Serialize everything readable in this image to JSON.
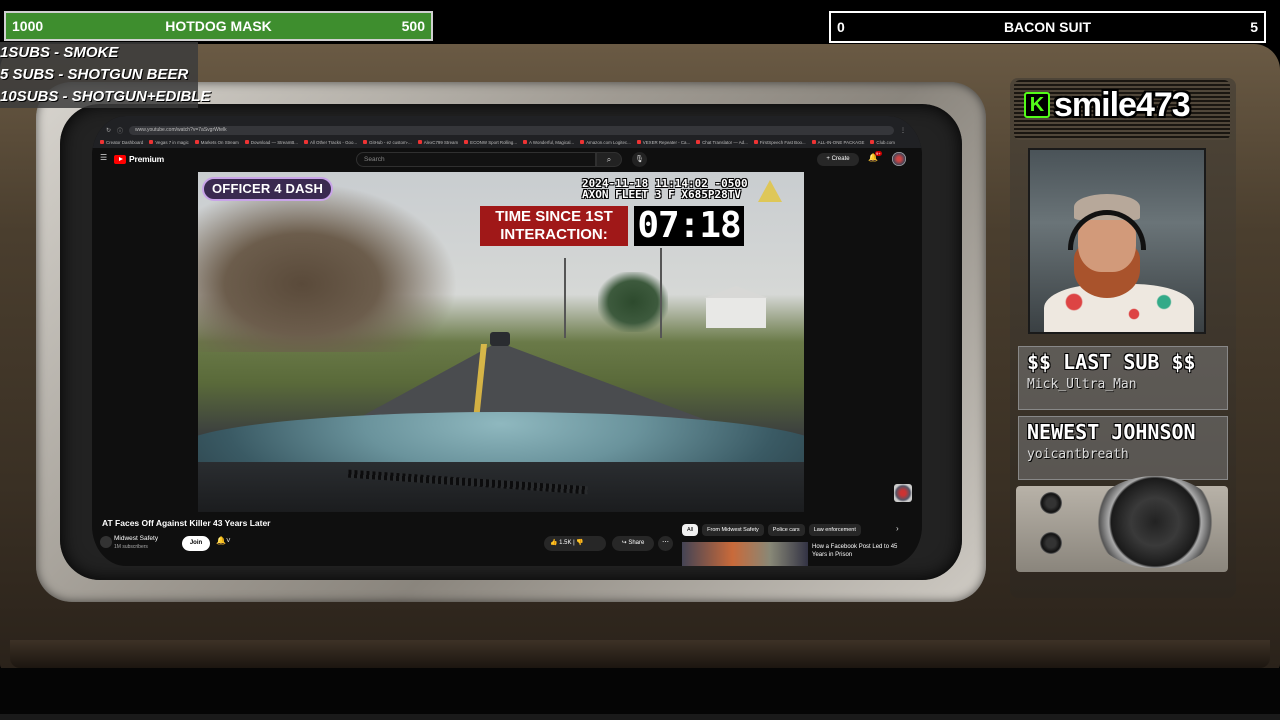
{
  "goals": {
    "left": {
      "min": "1000",
      "title": "HOTDOG MASK",
      "max": "500"
    },
    "right": {
      "min": "0",
      "title": "BACON SUIT",
      "max": "5"
    }
  },
  "sub_rewards": [
    "1SUBS   - SMOKE",
    "5 SUBS  - SHOTGUN BEER",
    "10SUBS - SHOTGUN+EDIBLE"
  ],
  "browser": {
    "url": "www.youtube.com/watch?v=7aSvgrWtelk",
    "bookmarks": [
      "Creator Dashboard",
      "Vegas 7 in magic",
      "Markets On Stream",
      "Download — StreamB...",
      "All Other Tracks - Goo...",
      "GitHub - ez custom-...",
      "AlexC799 Stream",
      "ECONW Sport Rolling...",
      "A Wonderful, Magical...",
      "Amazon.com Logitec...",
      "VEXER Repeater - Ca...",
      "Chat Translator — Ad...",
      "FirstSpeech Fast Boo...",
      "ALL-IN-ONE PACKAGE",
      "Club.com"
    ]
  },
  "youtube": {
    "logo_text": "Premium",
    "search_placeholder": "Search",
    "create_label": "Create",
    "video": {
      "badge": "OFFICER 4 DASH",
      "timestamp_line1": "2024-11-18 11:14:02 -0500",
      "timestamp_line2": "AXON FLEET 3 F X685P28TV",
      "time_since_line1": "TIME SINCE 1ST",
      "time_since_line2": "INTERACTION:",
      "timer": "07:18"
    },
    "title": "AT Faces Off Against Killer 43 Years Later",
    "channel": {
      "name": "Midwest Safety",
      "subs": "1M subscribers"
    },
    "join_label": "Join",
    "likes": "1.5K",
    "share_label": "Share",
    "chips": [
      "All",
      "From Midwest Safety",
      "Police cars",
      "Law enforcement"
    ],
    "recommended_title": "How a Facebook Post Led to 45 Years in Prison"
  },
  "streamer": {
    "platform_letter": "K",
    "name": "smile473"
  },
  "last_sub": {
    "label": "$$ LAST SUB $$",
    "value": "Mick_Ultra_Man"
  },
  "newest": {
    "label": "NEWEST JOHNSON",
    "value": "yoicantbreath"
  },
  "colors": {
    "goal_green": "#3e8e2e",
    "kick_green": "#53fc18",
    "yt_red": "#ff0000"
  }
}
